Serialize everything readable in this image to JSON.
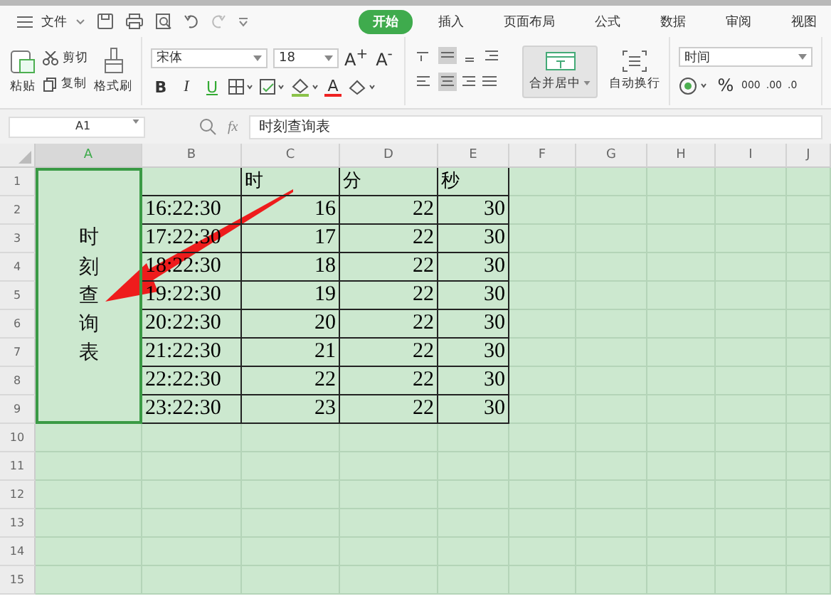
{
  "menu": {
    "label": "文件"
  },
  "tabs": [
    {
      "label": "开始",
      "selected": true
    },
    {
      "label": "插入",
      "selected": false
    },
    {
      "label": "页面布局",
      "selected": false
    },
    {
      "label": "公式",
      "selected": false
    },
    {
      "label": "数据",
      "selected": false
    },
    {
      "label": "审阅",
      "selected": false
    },
    {
      "label": "视图",
      "selected": false
    }
  ],
  "clipboard": {
    "paste": "粘贴",
    "cut": "剪切",
    "copy": "复制",
    "format_painter": "格式刷"
  },
  "font": {
    "name": "宋体",
    "size": "18",
    "grow": "A$^{+}$",
    "shrink": "A$^{-}$",
    "bold": "B",
    "italic": "I",
    "underline": "U",
    "font_color": "A"
  },
  "alignment": {
    "merge": "合并居中",
    "wrap": "自动换行"
  },
  "number": {
    "format": "时间",
    "percent": "%",
    "thousands": "000",
    "add_decimal": ".00",
    "remove_decimal": ".0"
  },
  "formula_bar": {
    "name_box": "A1",
    "fx": "fx",
    "formula": "时刻查询表"
  },
  "sheet": {
    "columns": [
      {
        "label": "A",
        "selected": true
      },
      {
        "label": "B",
        "selected": false
      },
      {
        "label": "C",
        "selected": false
      },
      {
        "label": "D",
        "selected": false
      },
      {
        "label": "E",
        "selected": false
      },
      {
        "label": "F",
        "selected": false
      },
      {
        "label": "G",
        "selected": false
      },
      {
        "label": "H",
        "selected": false
      },
      {
        "label": "I",
        "selected": false
      },
      {
        "label": "J",
        "selected": false
      }
    ],
    "merged_cell": {
      "text": "时刻查询表",
      "selected": true
    },
    "rows": [
      {
        "label": "1",
        "kind": "header",
        "cells": {
          "C": "时",
          "D": "分",
          "E": "秒"
        }
      },
      {
        "label": "2",
        "kind": "data",
        "cells": {
          "B": "16:22:30",
          "C": "16",
          "D": "22",
          "E": "30"
        }
      },
      {
        "label": "3",
        "kind": "data",
        "cells": {
          "B": "17:22:30",
          "C": "17",
          "D": "22",
          "E": "30"
        }
      },
      {
        "label": "4",
        "kind": "data",
        "cells": {
          "B": "18:22:30",
          "C": "18",
          "D": "22",
          "E": "30"
        }
      },
      {
        "label": "5",
        "kind": "data",
        "cells": {
          "B": "19:22:30",
          "C": "19",
          "D": "22",
          "E": "30"
        }
      },
      {
        "label": "6",
        "kind": "data",
        "cells": {
          "B": "20:22:30",
          "C": "20",
          "D": "22",
          "E": "30"
        }
      },
      {
        "label": "7",
        "kind": "data",
        "cells": {
          "B": "21:22:30",
          "C": "21",
          "D": "22",
          "E": "30"
        }
      },
      {
        "label": "8",
        "kind": "data",
        "cells": {
          "B": "22:22:30",
          "C": "22",
          "D": "22",
          "E": "30"
        }
      },
      {
        "label": "9",
        "kind": "data",
        "cells": {
          "B": "23:22:30",
          "C": "23",
          "D": "22",
          "E": "30"
        }
      },
      {
        "label": "10",
        "kind": "empty",
        "cells": {}
      },
      {
        "label": "11",
        "kind": "empty",
        "cells": {}
      },
      {
        "label": "12",
        "kind": "empty",
        "cells": {}
      },
      {
        "label": "13",
        "kind": "empty",
        "cells": {}
      },
      {
        "label": "14",
        "kind": "empty",
        "cells": {}
      },
      {
        "label": "15",
        "kind": "empty",
        "cells": {}
      }
    ]
  }
}
